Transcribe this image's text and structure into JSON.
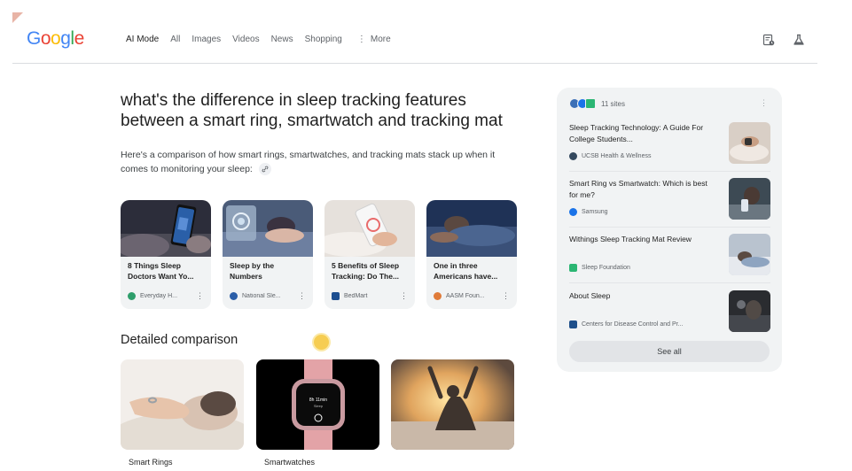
{
  "header": {
    "logo_letters": [
      {
        "ch": "G",
        "color": "#4285F4"
      },
      {
        "ch": "o",
        "color": "#EA4335"
      },
      {
        "ch": "o",
        "color": "#FBBC05"
      },
      {
        "ch": "g",
        "color": "#4285F4"
      },
      {
        "ch": "l",
        "color": "#34A853"
      },
      {
        "ch": "e",
        "color": "#EA4335"
      }
    ],
    "tabs": [
      {
        "label": "AI Mode",
        "active": true
      },
      {
        "label": "All"
      },
      {
        "label": "Images"
      },
      {
        "label": "Videos"
      },
      {
        "label": "News"
      },
      {
        "label": "Shopping"
      }
    ],
    "more": {
      "dots": "⋮",
      "label": "More"
    },
    "icons": [
      "history-icon",
      "labs-flask-icon"
    ]
  },
  "main": {
    "query": "what's the difference in sleep tracking features between a smart ring, smartwatch and tracking mat",
    "intro": "Here's a comparison of how smart rings, smartwatches, and tracking mats stack up when it comes to monitoring your sleep:",
    "cards": [
      {
        "title": "8 Things Sleep Doctors Want Yo...",
        "source": "Everyday H...",
        "fav_color": "#2e9e6b",
        "menu": "⋮"
      },
      {
        "title": "Sleep by the Numbers",
        "source": "National Sle...",
        "fav_color": "#2b5ea8",
        "menu": "⋮"
      },
      {
        "title": "5 Benefits of Sleep Tracking: Do The...",
        "source": "BedMart",
        "fav_color": "#1d4f91",
        "menu": "⋮"
      },
      {
        "title": "One in three Americans have...",
        "source": "AASM Foun...",
        "fav_color": "#e07b39",
        "menu": "⋮"
      }
    ],
    "section_title": "Detailed comparison",
    "comparisons": [
      {
        "label": "Smart Rings"
      },
      {
        "label": "Smartwatches"
      },
      {
        "label": ""
      }
    ],
    "watch_screen": {
      "line1": "8h 11min",
      "line2": "Sleep"
    }
  },
  "sources_panel": {
    "count_label": "11 sites",
    "menu": "⋮",
    "head_favicons": [
      "#3b6fb6",
      "#1a73e8",
      "#2bb673"
    ],
    "items": [
      {
        "title": "Sleep Tracking Technology: A Guide For College Students...",
        "source": "UCSB Health & Wellness",
        "fav_color": "#34495e"
      },
      {
        "title": "Smart Ring vs Smartwatch: Which is best for me?",
        "source": "Samsung",
        "fav_color": "#1a73e8"
      },
      {
        "title": "Withings Sleep Tracking Mat Review",
        "source": "Sleep Foundation",
        "fav_color": "#2bb673"
      },
      {
        "title": "About Sleep",
        "source": "Centers for Disease Control and Pr...",
        "fav_color": "#1e4f8a"
      }
    ],
    "see_all": "See all"
  },
  "colors": {
    "divider": "#dadce0",
    "panel_bg": "#f1f3f4",
    "cursor_dot": "#f6cd52"
  }
}
